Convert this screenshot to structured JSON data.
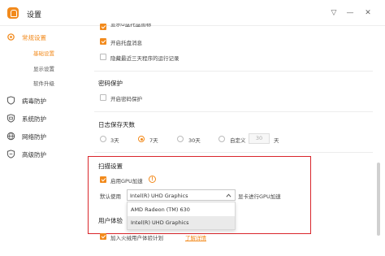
{
  "window": {
    "title": "设置",
    "controls": [
      "▽",
      "—",
      "✕"
    ]
  },
  "sidebar": {
    "items": [
      {
        "label": "常规设置",
        "icon": "gear-icon",
        "color": "#f28a1c"
      },
      {
        "label": "病毒防护",
        "icon": "shield-icon"
      },
      {
        "label": "系统防护",
        "icon": "system-shield-icon"
      },
      {
        "label": "网络防护",
        "icon": "globe-icon"
      },
      {
        "label": "高级防护",
        "icon": "advanced-shield-icon"
      }
    ],
    "subitems": [
      "基础设置",
      "显示设置",
      "软件升级"
    ]
  },
  "content": {
    "top_options": [
      {
        "label": "显示U盘托盘图标",
        "checked": true
      },
      {
        "label": "开启托盘消息",
        "checked": true
      },
      {
        "label": "隐藏最近三天程序的运行记录",
        "checked": false
      }
    ],
    "password": {
      "title": "密码保护",
      "option": {
        "label": "开启密码保护",
        "checked": false
      }
    },
    "log": {
      "title": "日志保存天数",
      "options": [
        "3天",
        "7天",
        "30天",
        "自定义"
      ],
      "selected": "7天",
      "custom_value": "30",
      "unit": "天"
    },
    "scan": {
      "title": "扫描设置",
      "gpu_label": "启用GPU加速",
      "gpu_checked": true,
      "info_glyph": "!",
      "default_label": "默认使用",
      "selected_gpu": "Intel(R) UHD Graphics",
      "suffix": "显卡进行GPU加速",
      "gpu_options": [
        "AMD Radeon (TM) 630",
        "Intel(R) UHD Graphics"
      ]
    },
    "experience": {
      "title": "用户体验",
      "option": {
        "label": "加入火绒用户体验计划",
        "checked": true
      },
      "link": "了解详情"
    }
  },
  "accent_color": "#f28a1c",
  "highlight_color": "#d9262b"
}
